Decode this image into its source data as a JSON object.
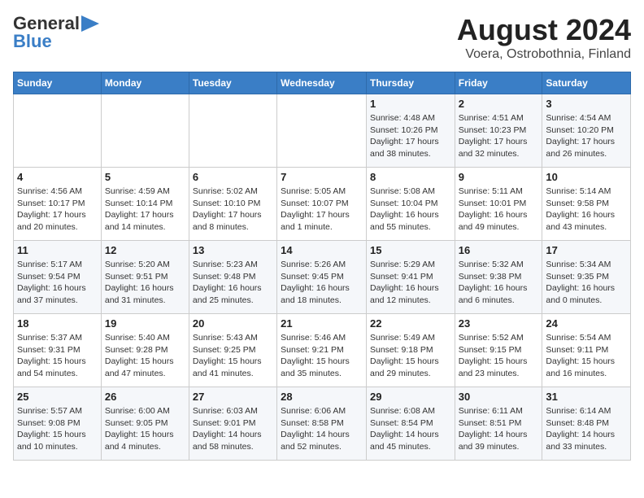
{
  "logo": {
    "line1": "General",
    "line2": "Blue"
  },
  "title": "August 2024",
  "subtitle": "Voera, Ostrobothnia, Finland",
  "days_header": [
    "Sunday",
    "Monday",
    "Tuesday",
    "Wednesday",
    "Thursday",
    "Friday",
    "Saturday"
  ],
  "weeks": [
    [
      {
        "num": "",
        "info": ""
      },
      {
        "num": "",
        "info": ""
      },
      {
        "num": "",
        "info": ""
      },
      {
        "num": "",
        "info": ""
      },
      {
        "num": "1",
        "info": "Sunrise: 4:48 AM\nSunset: 10:26 PM\nDaylight: 17 hours\nand 38 minutes."
      },
      {
        "num": "2",
        "info": "Sunrise: 4:51 AM\nSunset: 10:23 PM\nDaylight: 17 hours\nand 32 minutes."
      },
      {
        "num": "3",
        "info": "Sunrise: 4:54 AM\nSunset: 10:20 PM\nDaylight: 17 hours\nand 26 minutes."
      }
    ],
    [
      {
        "num": "4",
        "info": "Sunrise: 4:56 AM\nSunset: 10:17 PM\nDaylight: 17 hours\nand 20 minutes."
      },
      {
        "num": "5",
        "info": "Sunrise: 4:59 AM\nSunset: 10:14 PM\nDaylight: 17 hours\nand 14 minutes."
      },
      {
        "num": "6",
        "info": "Sunrise: 5:02 AM\nSunset: 10:10 PM\nDaylight: 17 hours\nand 8 minutes."
      },
      {
        "num": "7",
        "info": "Sunrise: 5:05 AM\nSunset: 10:07 PM\nDaylight: 17 hours\nand 1 minute."
      },
      {
        "num": "8",
        "info": "Sunrise: 5:08 AM\nSunset: 10:04 PM\nDaylight: 16 hours\nand 55 minutes."
      },
      {
        "num": "9",
        "info": "Sunrise: 5:11 AM\nSunset: 10:01 PM\nDaylight: 16 hours\nand 49 minutes."
      },
      {
        "num": "10",
        "info": "Sunrise: 5:14 AM\nSunset: 9:58 PM\nDaylight: 16 hours\nand 43 minutes."
      }
    ],
    [
      {
        "num": "11",
        "info": "Sunrise: 5:17 AM\nSunset: 9:54 PM\nDaylight: 16 hours\nand 37 minutes."
      },
      {
        "num": "12",
        "info": "Sunrise: 5:20 AM\nSunset: 9:51 PM\nDaylight: 16 hours\nand 31 minutes."
      },
      {
        "num": "13",
        "info": "Sunrise: 5:23 AM\nSunset: 9:48 PM\nDaylight: 16 hours\nand 25 minutes."
      },
      {
        "num": "14",
        "info": "Sunrise: 5:26 AM\nSunset: 9:45 PM\nDaylight: 16 hours\nand 18 minutes."
      },
      {
        "num": "15",
        "info": "Sunrise: 5:29 AM\nSunset: 9:41 PM\nDaylight: 16 hours\nand 12 minutes."
      },
      {
        "num": "16",
        "info": "Sunrise: 5:32 AM\nSunset: 9:38 PM\nDaylight: 16 hours\nand 6 minutes."
      },
      {
        "num": "17",
        "info": "Sunrise: 5:34 AM\nSunset: 9:35 PM\nDaylight: 16 hours\nand 0 minutes."
      }
    ],
    [
      {
        "num": "18",
        "info": "Sunrise: 5:37 AM\nSunset: 9:31 PM\nDaylight: 15 hours\nand 54 minutes."
      },
      {
        "num": "19",
        "info": "Sunrise: 5:40 AM\nSunset: 9:28 PM\nDaylight: 15 hours\nand 47 minutes."
      },
      {
        "num": "20",
        "info": "Sunrise: 5:43 AM\nSunset: 9:25 PM\nDaylight: 15 hours\nand 41 minutes."
      },
      {
        "num": "21",
        "info": "Sunrise: 5:46 AM\nSunset: 9:21 PM\nDaylight: 15 hours\nand 35 minutes."
      },
      {
        "num": "22",
        "info": "Sunrise: 5:49 AM\nSunset: 9:18 PM\nDaylight: 15 hours\nand 29 minutes."
      },
      {
        "num": "23",
        "info": "Sunrise: 5:52 AM\nSunset: 9:15 PM\nDaylight: 15 hours\nand 23 minutes."
      },
      {
        "num": "24",
        "info": "Sunrise: 5:54 AM\nSunset: 9:11 PM\nDaylight: 15 hours\nand 16 minutes."
      }
    ],
    [
      {
        "num": "25",
        "info": "Sunrise: 5:57 AM\nSunset: 9:08 PM\nDaylight: 15 hours\nand 10 minutes."
      },
      {
        "num": "26",
        "info": "Sunrise: 6:00 AM\nSunset: 9:05 PM\nDaylight: 15 hours\nand 4 minutes."
      },
      {
        "num": "27",
        "info": "Sunrise: 6:03 AM\nSunset: 9:01 PM\nDaylight: 14 hours\nand 58 minutes."
      },
      {
        "num": "28",
        "info": "Sunrise: 6:06 AM\nSunset: 8:58 PM\nDaylight: 14 hours\nand 52 minutes."
      },
      {
        "num": "29",
        "info": "Sunrise: 6:08 AM\nSunset: 8:54 PM\nDaylight: 14 hours\nand 45 minutes."
      },
      {
        "num": "30",
        "info": "Sunrise: 6:11 AM\nSunset: 8:51 PM\nDaylight: 14 hours\nand 39 minutes."
      },
      {
        "num": "31",
        "info": "Sunrise: 6:14 AM\nSunset: 8:48 PM\nDaylight: 14 hours\nand 33 minutes."
      }
    ]
  ]
}
